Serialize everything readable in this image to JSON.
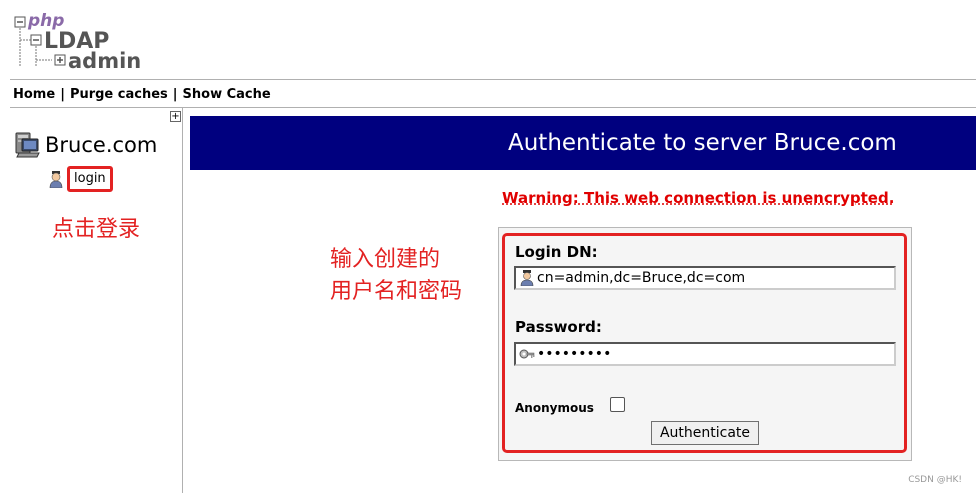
{
  "logo": {
    "php": "php",
    "ldap": "LDAP",
    "admin": "admin"
  },
  "menu": {
    "items": [
      "Home",
      "Purge caches",
      "Show Cache"
    ],
    "separator": "|"
  },
  "tree": {
    "expand_symbol": "+",
    "server_name": "Bruce.com",
    "login_label": "login"
  },
  "annotations": {
    "click_login": "点击登录",
    "input_line1": "输入创建的",
    "input_line2": "用户名和密码"
  },
  "main": {
    "title": "Authenticate to server Bruce.com",
    "warning": "Warning: This web connection is unencrypted."
  },
  "form": {
    "login_dn_label": "Login DN:",
    "login_dn_value": "cn=admin,dc=Bruce,dc=com",
    "password_label": "Password:",
    "password_value": "•••••••••",
    "anonymous_label": "Anonymous",
    "anonymous_checked": false,
    "submit_label": "Authenticate"
  },
  "watermark": "CSDN @HK!",
  "colors": {
    "title_bar": "#00007f",
    "warning": "#e00000",
    "annotation": "#e32222",
    "logo_text": "#555555",
    "logo_php": "#8a6aa8"
  }
}
